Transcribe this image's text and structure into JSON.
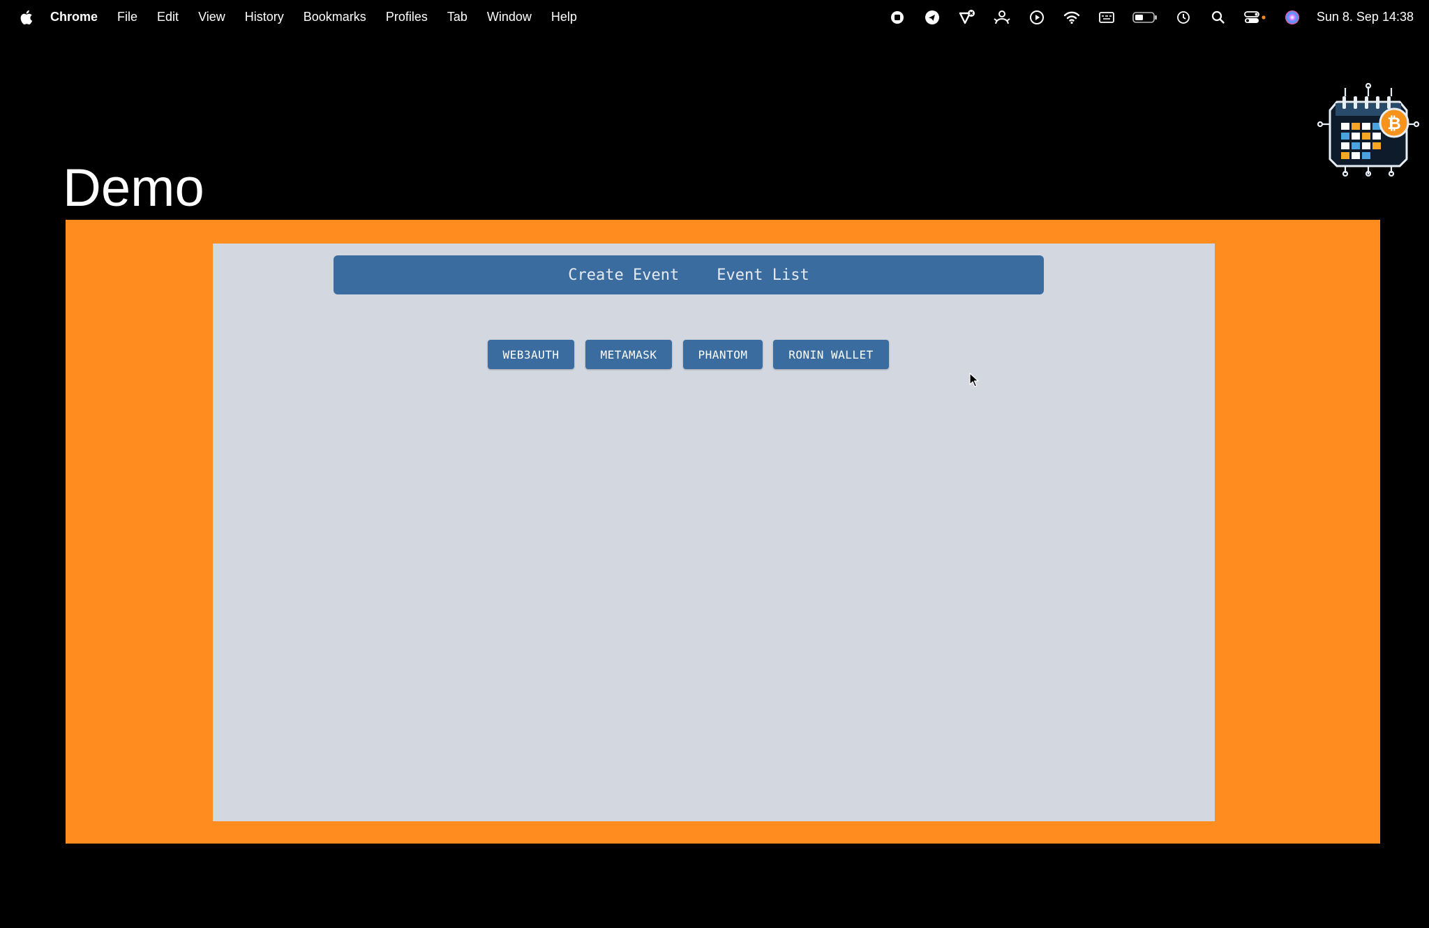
{
  "menubar": {
    "app_name": "Chrome",
    "items": [
      "File",
      "Edit",
      "View",
      "History",
      "Bookmarks",
      "Profiles",
      "Tab",
      "Window",
      "Help"
    ],
    "status_icons": [
      "record-icon",
      "telegram-icon",
      "vpn-icon",
      "user-share-icon",
      "play-icon",
      "wifi-icon",
      "keyboard-icon",
      "battery-icon",
      "time-machine-icon",
      "spotlight-icon",
      "control-center-icon",
      "siri-icon"
    ],
    "clock": "Sun 8. Sep  14:38"
  },
  "page": {
    "title": "Demo",
    "frame_color": "#ff8c1e",
    "logo_icon": "calendar-bitcoin-logo"
  },
  "app": {
    "nav": {
      "create_event": "Create Event",
      "event_list": "Event List"
    },
    "wallet_buttons": [
      "WEB3AUTH",
      "METAMASK",
      "PHANTOM",
      "RONIN WALLET"
    ],
    "accent_color": "#3b6ca0"
  }
}
